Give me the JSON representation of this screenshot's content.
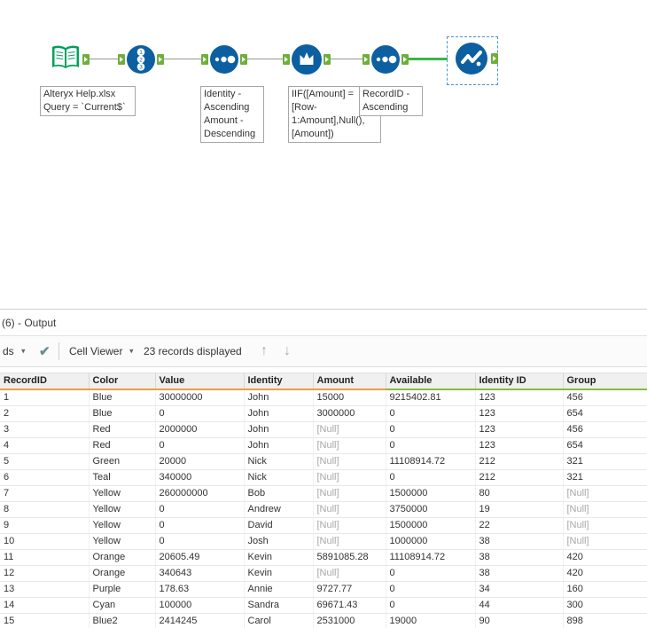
{
  "workflow": {
    "tools": {
      "input": {
        "annotation": "Alteryx Help.xlsx\nQuery = `Current$`"
      },
      "record_id": {},
      "sort1": {
        "annotation": "Identity -\nAscending\nAmount -\nDescending"
      },
      "multi_row_formula": {
        "annotation": "IIF([Amount] =\n[Row-\n1:Amount],Null(),\n[Amount])"
      },
      "sort2": {
        "annotation": "RecordID -\nAscending"
      },
      "browse": {
        "selected": true
      }
    },
    "record_id_digits": [
      "1",
      "2",
      "3"
    ]
  },
  "icons": {
    "caret_down": "▾",
    "check": "✔",
    "arrow_up": "↑",
    "arrow_down": "↓"
  },
  "results": {
    "panel_title": "(6) - Output",
    "toolbar": {
      "source_label": "ds",
      "cell_viewer_label": "Cell Viewer",
      "records_count": "23 records displayed"
    },
    "table": {
      "null_text": "[Null]",
      "columns": [
        {
          "label": "RecordID",
          "underline": "#e9a13b"
        },
        {
          "label": "Color",
          "underline": "#e9a13b"
        },
        {
          "label": "Value",
          "underline": "#e9a13b"
        },
        {
          "label": "Identity",
          "underline": "#e9a13b"
        },
        {
          "label": "Amount",
          "underline": "#e9a13b"
        },
        {
          "label": "Available",
          "underline": "#84bd41"
        },
        {
          "label": "Identity ID",
          "underline": "#84bd41"
        },
        {
          "label": "Group",
          "underline": "#84bd41"
        }
      ],
      "rows": [
        [
          "1",
          "Blue",
          "30000000",
          "John",
          "15000",
          "9215402.81",
          "123",
          "456"
        ],
        [
          "2",
          "Blue",
          "0",
          "John",
          "3000000",
          "0",
          "123",
          "654"
        ],
        [
          "3",
          "Red",
          "2000000",
          "John",
          "[Null]",
          "0",
          "123",
          "456"
        ],
        [
          "4",
          "Red",
          "0",
          "John",
          "[Null]",
          "0",
          "123",
          "654"
        ],
        [
          "5",
          "Green",
          "20000",
          "Nick",
          "[Null]",
          "11108914.72",
          "212",
          "321"
        ],
        [
          "6",
          "Teal",
          "340000",
          "Nick",
          "[Null]",
          "0",
          "212",
          "321"
        ],
        [
          "7",
          "Yellow",
          "260000000",
          "Bob",
          "[Null]",
          "1500000",
          "80",
          "[Null]"
        ],
        [
          "8",
          "Yellow",
          "0",
          "Andrew",
          "[Null]",
          "3750000",
          "19",
          "[Null]"
        ],
        [
          "9",
          "Yellow",
          "0",
          "David",
          "[Null]",
          "1500000",
          "22",
          "[Null]"
        ],
        [
          "10",
          "Yellow",
          "0",
          "Josh",
          "[Null]",
          "1000000",
          "38",
          "[Null]"
        ],
        [
          "11",
          "Orange",
          "20605.49",
          "Kevin",
          "5891085.28",
          "11108914.72",
          "38",
          "420"
        ],
        [
          "12",
          "Orange",
          "340643",
          "Kevin",
          "[Null]",
          "0",
          "38",
          "420"
        ],
        [
          "13",
          "Purple",
          "178.63",
          "Annie",
          "9727.77",
          "0",
          "34",
          "160"
        ],
        [
          "14",
          "Cyan",
          "100000",
          "Sandra",
          "69671.43",
          "0",
          "44",
          "300"
        ],
        [
          "15",
          "Blue2",
          "2414245",
          "Carol",
          "2531000",
          "19000",
          "90",
          "898"
        ]
      ]
    }
  },
  "colors": {
    "tool_blue": "#0c5fa0",
    "input_green": "#00a05a",
    "anchor_green": "#6fae3a",
    "selected_wire_green": "#3bb54a",
    "selection_border_blue": "#4a90d2",
    "header_underline_orange": "#e9a13b",
    "header_underline_green": "#84bd41"
  }
}
